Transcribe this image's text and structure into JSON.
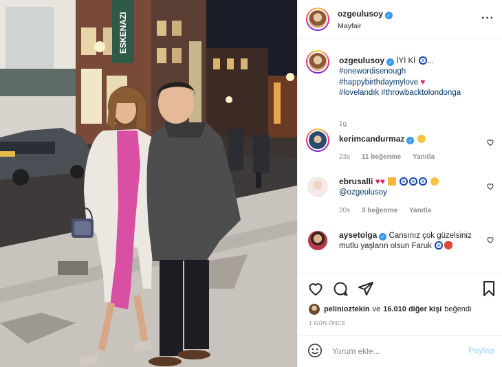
{
  "header": {
    "username": "ozgeulusoy",
    "location": "Mayfair",
    "more_icon": "more-horizontal-icon"
  },
  "photo": {
    "sign_text": "ESKENAZI",
    "description_icon": "street-photo"
  },
  "caption": {
    "username": "ozgeulusoy",
    "text_start": "İYİ Kİ",
    "hashtags": [
      "#onewordisenough",
      "#happybirthdaymylove",
      "#lovelandık",
      "#throwbacktolondonga"
    ],
    "time": "1g"
  },
  "comments": [
    {
      "username": "kerimcandurmaz",
      "time": "23s",
      "likes": "11 beğenme",
      "reply": "Yanıtla"
    },
    {
      "username": "ebrusalli",
      "mention": "@ozgeulusoy",
      "time": "20s",
      "likes": "3 beğenme",
      "reply": "Yanıtla"
    },
    {
      "username": "aysetolga",
      "text": "Cansınız çok güzelsiniz mutlu yaşların olsun Faruk",
      "time": "",
      "likes": "",
      "reply": ""
    }
  ],
  "actions": {
    "like_icon": "heart-icon",
    "comment_icon": "comment-icon",
    "share_icon": "share-icon",
    "save_icon": "bookmark-icon"
  },
  "likes": {
    "user": "pelinioztekin",
    "connector": "ve",
    "count": "16.010 diğer kişi",
    "suffix": "beğendi"
  },
  "post_time": "1 GÜN ÖNCE",
  "add_comment": {
    "placeholder": "Yorum ekle...",
    "post_label": "Paylaş"
  },
  "colors": {
    "verified": "#3897f0",
    "hashtag": "#00376b",
    "post_button": "#b2dffc",
    "border": "#efefef"
  }
}
